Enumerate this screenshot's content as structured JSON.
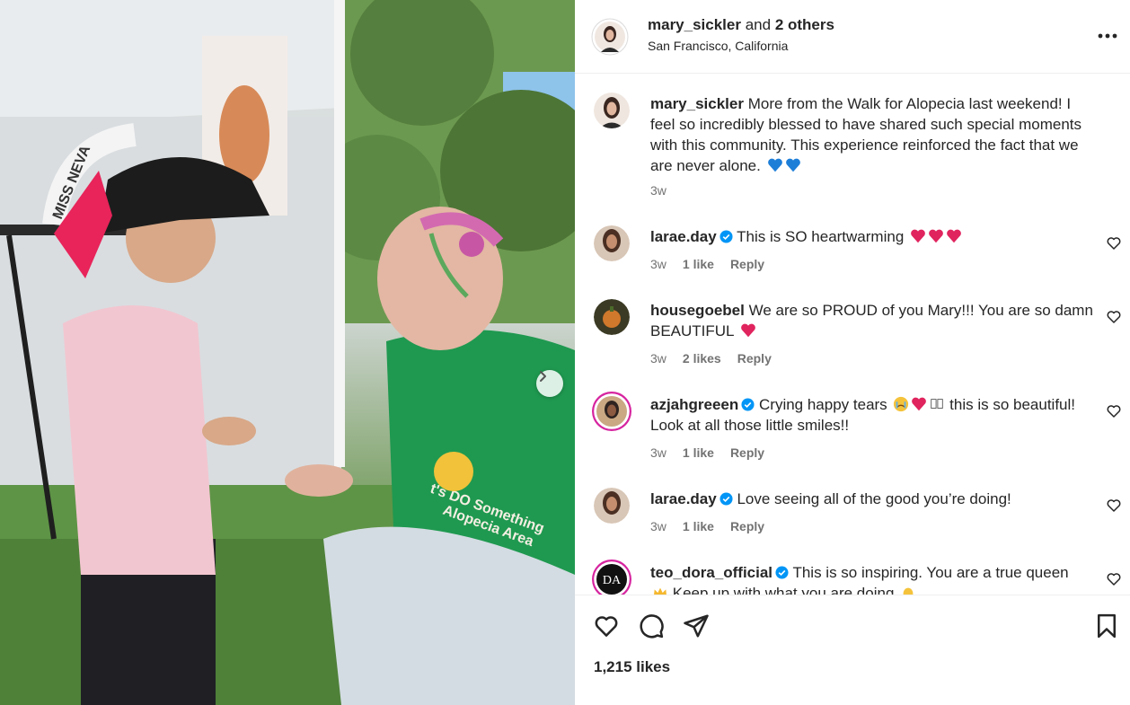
{
  "post": {
    "author": "mary_sickler",
    "and_text": "and",
    "others": "2 others",
    "location": "San Francisco, California",
    "likes": "1,215 likes"
  },
  "caption": {
    "user": "mary_sickler",
    "text": "More from the Walk for Alopecia last weekend! I feel so incredibly blessed to have shared such special moments with this community. This experience reinforced the fact that we are never alone.",
    "time": "3w"
  },
  "comments": [
    {
      "user": "larae.day",
      "verified": true,
      "text": "This is SO heartwarming",
      "time": "3w",
      "likes": "1 like",
      "reply": "Reply"
    },
    {
      "user": "housegoebel",
      "verified": false,
      "text": "We are so PROUD of you Mary!!! You are so damn BEAUTIFUL",
      "time": "3w",
      "likes": "2 likes",
      "reply": "Reply"
    },
    {
      "user": "azjahgreeen",
      "verified": true,
      "text_before": "Crying happy tears",
      "text_after": "this is so beautiful! Look at all those little smiles!!",
      "time": "3w",
      "likes": "1 like",
      "reply": "Reply"
    },
    {
      "user": "larae.day",
      "verified": true,
      "text": "Love seeing all of the good you’re doing!",
      "time": "3w",
      "likes": "1 like",
      "reply": "Reply"
    },
    {
      "user": "teo_dora_official",
      "verified": true,
      "text": "This is so inspiring. You are a true queen",
      "text_line2": "Keep up with what you are doing"
    }
  ],
  "photo": {
    "shirt_text_1": "t's DO Something",
    "shirt_text_2": "Alopecia Area",
    "sash_text": "MISS NEVA"
  },
  "icons": {
    "more": "more-horizontal-icon",
    "like": "heart-icon",
    "comment": "comment-icon",
    "share": "paper-plane-icon",
    "save": "bookmark-icon",
    "next": "chevron-right-icon",
    "verified": "verified-badge-icon"
  },
  "colors": {
    "verified": "#0095f6",
    "heart_red": "#e0245e",
    "blue_heart": "#1d7ed8",
    "muted": "#737373"
  }
}
